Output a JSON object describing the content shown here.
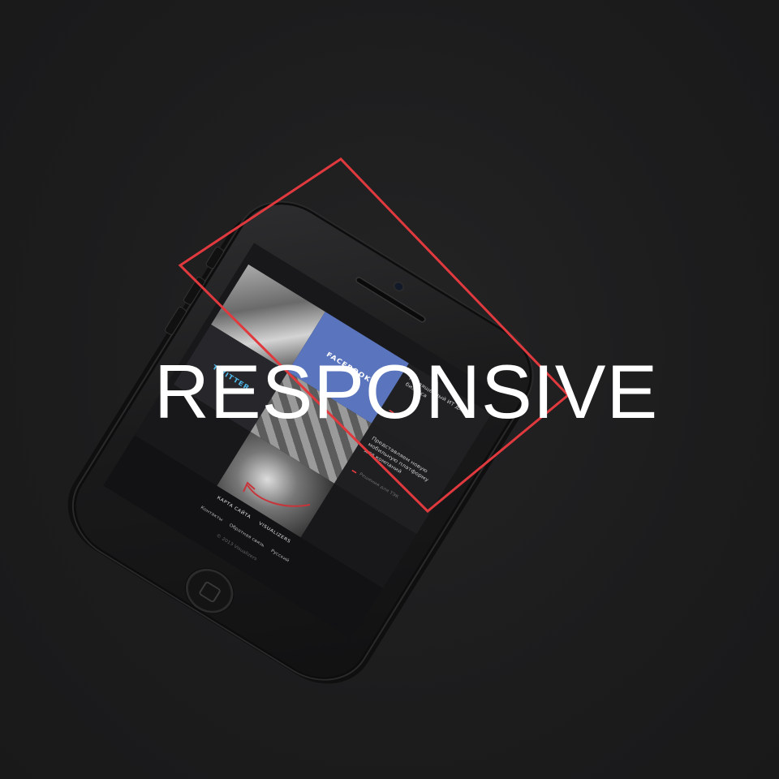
{
  "headline": "RESPONSIVE",
  "screen": {
    "tile_text_1": "Посвященный ИТ для бизнеса",
    "facebook_label": "FACEBOOK",
    "twitter_label": "TWITTER",
    "tile_text_2": "Представляем новую мобильную платформу для компаний",
    "tile_text_3": "Решения для ТЭК",
    "footer": {
      "sitemap": "КАРТА САЙТА",
      "brand": "VISUALIZERS",
      "links": [
        "Контакты",
        "Обратная связь",
        "Русский"
      ],
      "copyright": "© 2013 Visualizers"
    }
  },
  "colors": {
    "background": "#1d1d1e",
    "accent_red": "#e0393e",
    "facebook_blue": "#5a75bd",
    "twitter_cyan": "#4fb6e6"
  },
  "icons": {
    "arrow": "curved-arrow-icon",
    "home": "home-button-icon"
  }
}
